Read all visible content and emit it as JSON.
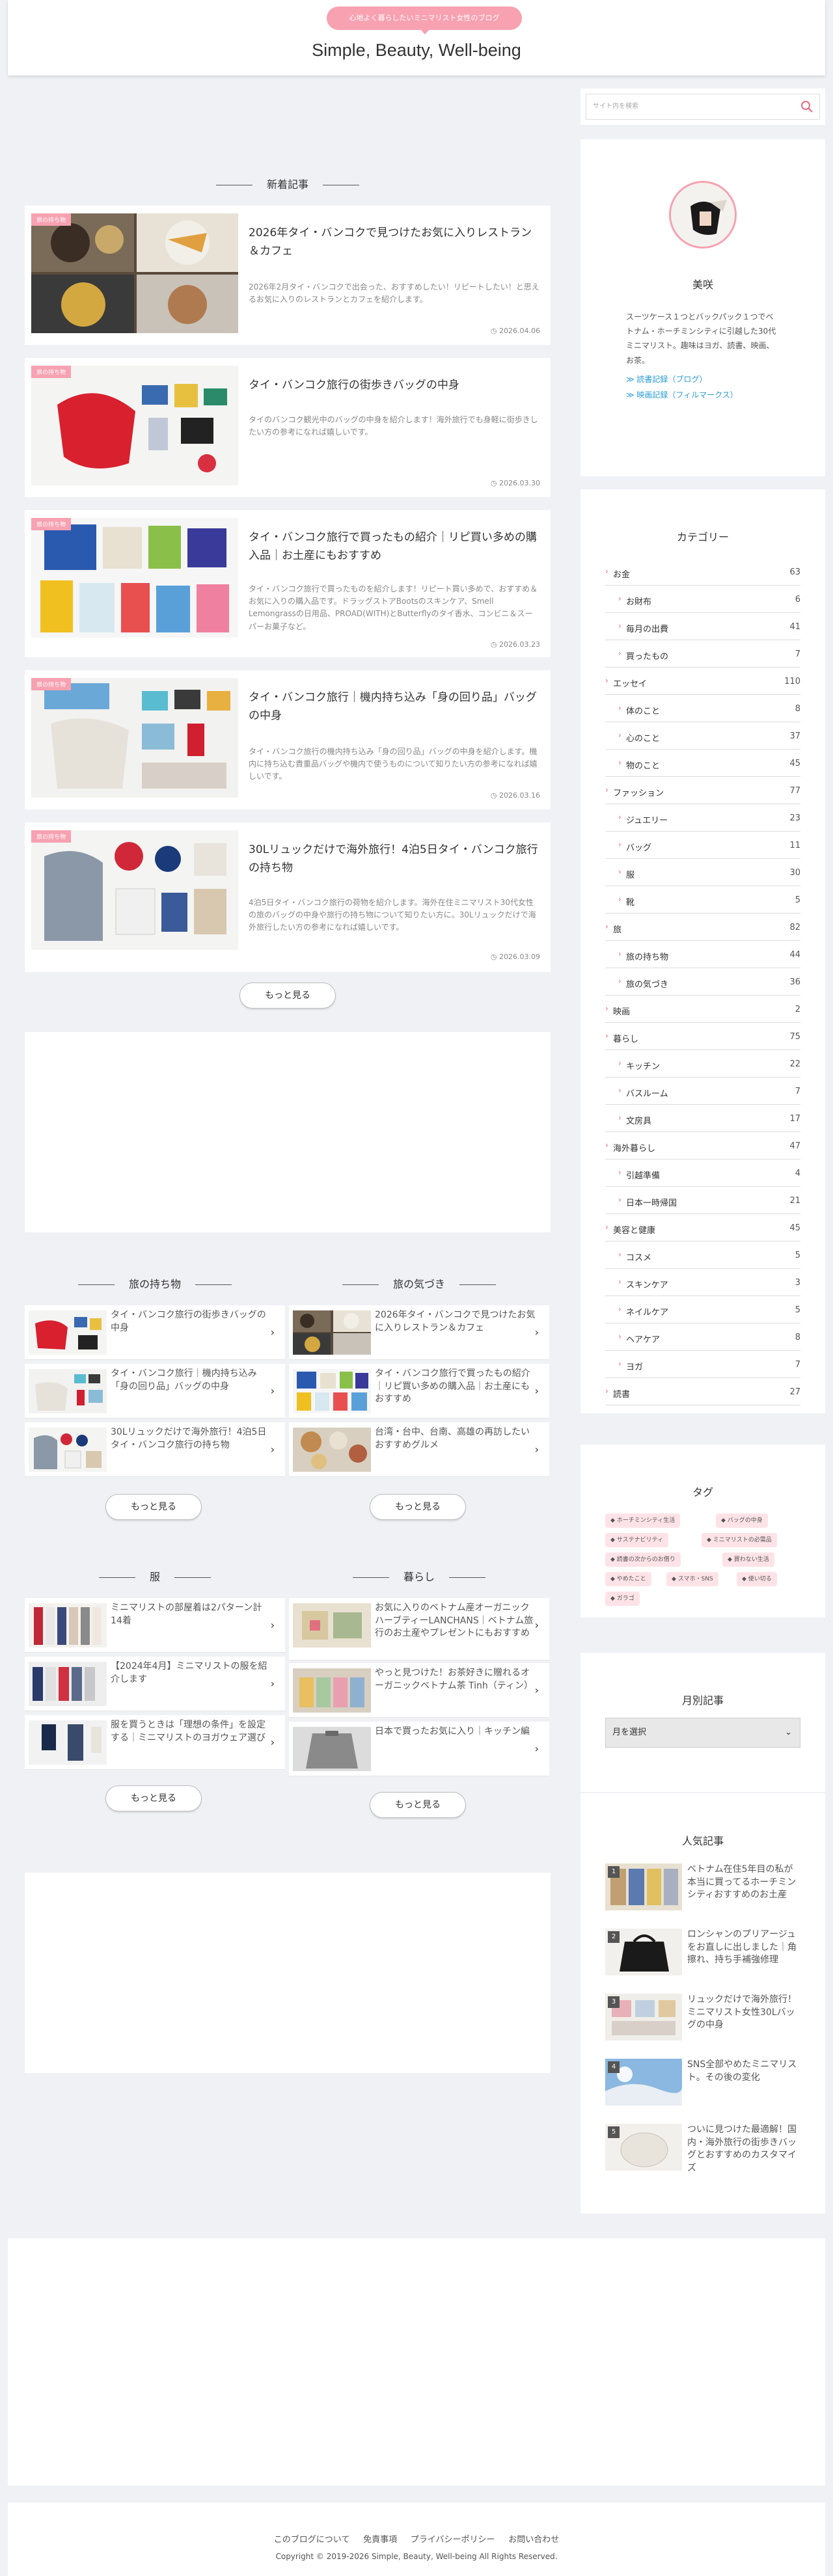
{
  "header": {
    "tagline": "心地よく暮らしたいミニマリスト女性のブログ",
    "title": "Simple, Beauty, Well-being"
  },
  "colors": {
    "accent": "#f7a1b1",
    "link": "#2a9bd4"
  },
  "new_posts": {
    "heading": "新着記事",
    "items": [
      {
        "category": "旅の持ち物",
        "title": "2026年タイ・バンコクで見つけたお気に入りレストラン＆カフェ",
        "excerpt": "2026年2月タイ・バンコクで出会った、おすすめしたい！リピートしたい！と思えるお気に入りのレストランとカフェを紹介します。",
        "date": "2026.04.06"
      },
      {
        "category": "旅の持ち物",
        "title": "タイ・バンコク旅行の街歩きバッグの中身",
        "excerpt": "タイのバンコク観光中のバッグの中身を紹介します！海外旅行でも身軽に街歩きしたい方の参考になれば嬉しいです。",
        "date": "2026.03.30"
      },
      {
        "category": "旅の持ち物",
        "title": "タイ・バンコク旅行で買ったもの紹介｜リピ買い多めの購入品｜お土産にもおすすめ",
        "excerpt": "タイ・バンコク旅行で買ったものを紹介します！リピート買い多めで、おすすめ＆お気に入りの購入品です。ドラッグストアBootsのスキンケア、Smell Lemongrassの日用品、PROAD(WITH)とButterflyのタイ香水、コンビニ＆スーパーお菓子など。",
        "date": "2026.03.23"
      },
      {
        "category": "旅の持ち物",
        "title": "タイ・バンコク旅行｜機内持ち込み「身の回り品」バッグの中身",
        "excerpt": "タイ・バンコク旅行の機内持ち込み「身の回り品」バッグの中身を紹介します。機内に持ち込む貴重品バッグや機内で使うものについて知りたい方の参考になれば嬉しいです。",
        "date": "2026.03.16"
      },
      {
        "category": "旅の持ち物",
        "title": "30Lリュックだけで海外旅行！4泊5日タイ・バンコク旅行の持ち物",
        "excerpt": "4泊5日タイ・バンコク旅行の荷物を紹介します。海外在住ミニマリスト30代女性の旅のバッグの中身や旅行の持ち物について知りたい方に。30Lリュックだけで海外旅行したい方の参考になれば嬉しいです。",
        "date": "2026.03.09"
      }
    ],
    "more": "もっと見る"
  },
  "sections": [
    {
      "heading": "旅の持ち物",
      "more": "もっと見る",
      "items": [
        "タイ・バンコク旅行の街歩きバッグの中身",
        "タイ・バンコク旅行｜機内持ち込み「身の回り品」バッグの中身",
        "30Lリュックだけで海外旅行！4泊5日タイ・バンコク旅行の持ち物"
      ]
    },
    {
      "heading": "旅の気づき",
      "more": "もっと見る",
      "items": [
        "2026年タイ・バンコクで見つけたお気に入りレストラン＆カフェ",
        "タイ・バンコク旅行で買ったもの紹介｜リピ買い多めの購入品｜お土産にもおすすめ",
        "台湾・台中、台南、高雄の再訪したいおすすめグルメ"
      ]
    },
    {
      "heading": "服",
      "more": "もっと見る",
      "items": [
        "ミニマリストの部屋着は2パターン計14着",
        "【2024年4月】ミニマリストの服を紹介します",
        "服を買うときは「理想の条件」を設定する｜ミニマリストのヨガウェア選び"
      ]
    },
    {
      "heading": "暮らし",
      "more": "もっと見る",
      "items": [
        "お気に入りのベトナム産オーガニックハーブティーLANCHANS｜ベトナム旅行のお土産やプレゼントにもおすすめ",
        "やっと見つけた！お茶好きに贈れるオーガニックベトナム茶 Tinh（ティン）",
        "日本で買ったお気に入り｜キッチン編"
      ]
    }
  ],
  "sidebar": {
    "search_placeholder": "サイト内を検索",
    "profile": {
      "name": "美咲",
      "bio": "スーツケース１つとバックパック１つでベトナム・ホーチミンシティに引越した30代ミニマリスト。趣味はヨガ、読書、映画、お茶。",
      "link1": "≫ 読書記録（ブログ）",
      "link2": "≫ 映画記録（フィルマークス）"
    },
    "categories": {
      "heading": "カテゴリー",
      "items": [
        {
          "label": "お金",
          "count": "63",
          "level": 0
        },
        {
          "label": "お財布",
          "count": "6",
          "level": 1
        },
        {
          "label": "毎月の出費",
          "count": "41",
          "level": 1
        },
        {
          "label": "買ったもの",
          "count": "7",
          "level": 1
        },
        {
          "label": "エッセイ",
          "count": "110",
          "level": 0
        },
        {
          "label": "体のこと",
          "count": "8",
          "level": 1
        },
        {
          "label": "心のこと",
          "count": "37",
          "level": 1
        },
        {
          "label": "物のこと",
          "count": "45",
          "level": 1
        },
        {
          "label": "ファッション",
          "count": "77",
          "level": 0
        },
        {
          "label": "ジュエリー",
          "count": "23",
          "level": 1
        },
        {
          "label": "バッグ",
          "count": "11",
          "level": 1
        },
        {
          "label": "服",
          "count": "30",
          "level": 1
        },
        {
          "label": "靴",
          "count": "5",
          "level": 1
        },
        {
          "label": "旅",
          "count": "82",
          "level": 0
        },
        {
          "label": "旅の持ち物",
          "count": "44",
          "level": 1
        },
        {
          "label": "旅の気づき",
          "count": "36",
          "level": 1
        },
        {
          "label": "映画",
          "count": "2",
          "level": 0
        },
        {
          "label": "暮らし",
          "count": "75",
          "level": 0
        },
        {
          "label": "キッチン",
          "count": "22",
          "level": 1
        },
        {
          "label": "バスルーム",
          "count": "7",
          "level": 1
        },
        {
          "label": "文房具",
          "count": "17",
          "level": 1
        },
        {
          "label": "海外暮らし",
          "count": "47",
          "level": 0
        },
        {
          "label": "引越準備",
          "count": "4",
          "level": 1
        },
        {
          "label": "日本一時帰国",
          "count": "21",
          "level": 1
        },
        {
          "label": "美容と健康",
          "count": "45",
          "level": 0
        },
        {
          "label": "コスメ",
          "count": "5",
          "level": 1
        },
        {
          "label": "スキンケア",
          "count": "3",
          "level": 1
        },
        {
          "label": "ネイルケア",
          "count": "5",
          "level": 1
        },
        {
          "label": "ヘアケア",
          "count": "8",
          "level": 1
        },
        {
          "label": "ヨガ",
          "count": "7",
          "level": 1
        },
        {
          "label": "読書",
          "count": "27",
          "level": 0
        }
      ]
    },
    "tags": {
      "heading": "タグ",
      "items": [
        "ホーチミンシティ生活",
        "バッグの中身",
        "サステナビリティ",
        "ミニマリストの必需品",
        "読書の次からのお借り",
        "買わない生活",
        "やめたこと",
        "スマホ・SNS",
        "使い切る",
        "ガラゴ"
      ]
    },
    "archive": {
      "heading": "月別記事",
      "select_value": "月を選択"
    },
    "popular": {
      "heading": "人気記事",
      "items": [
        {
          "rank": "1",
          "title": "ベトナム在住5年目の私が本当に買ってるホーチミンシティおすすめのお土産"
        },
        {
          "rank": "2",
          "title": "ロンシャンのプリアージュをお直しに出しました｜角擦れ、持ち手補強修理"
        },
        {
          "rank": "3",
          "title": "リュックだけで海外旅行！ミニマリスト女性30Lバッグの中身"
        },
        {
          "rank": "4",
          "title": "SNS全部やめたミニマリスト。その後の変化"
        },
        {
          "rank": "5",
          "title": "ついに見つけた最適解！国内・海外旅行の街歩きバッグとおすすめのカスタマイズ"
        }
      ]
    }
  },
  "footer": {
    "links": [
      "このブログについて",
      "免責事項",
      "プライバシーポリシー",
      "お問い合わせ"
    ],
    "copyright": "Copyright © 2019-2026 Simple, Beauty, Well-being All Rights Reserved."
  }
}
